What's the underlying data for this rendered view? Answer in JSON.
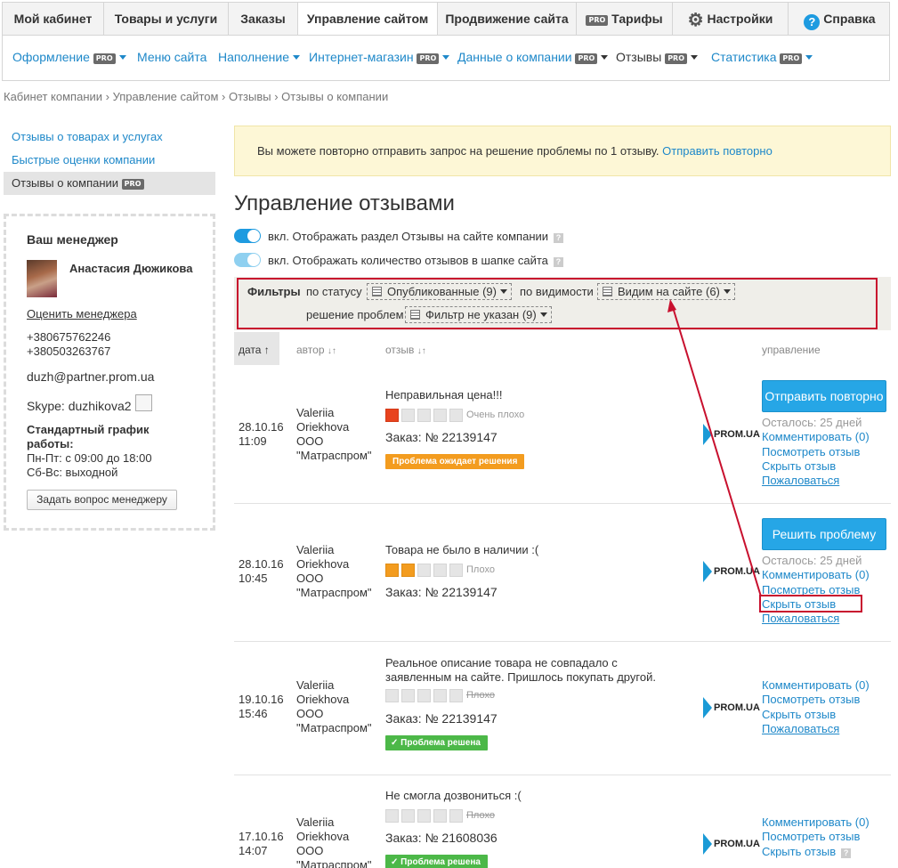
{
  "top_tabs": [
    {
      "label": "Мой кабинет"
    },
    {
      "label": "Товары и услуги"
    },
    {
      "label": "Заказы"
    },
    {
      "label": "Управление сайтом"
    },
    {
      "label": "Продвижение сайта"
    },
    {
      "label": "Тарифы",
      "pro": "PRO"
    },
    {
      "label": "Настройки"
    },
    {
      "label": "Справка"
    }
  ],
  "sub_nav": [
    {
      "label": "Оформление",
      "pro": "PRO"
    },
    {
      "label": "Меню сайта"
    },
    {
      "label": "Наполнение"
    },
    {
      "label": "Интернет-магазин",
      "pro": "PRO"
    },
    {
      "label": "Данные о компании",
      "pro": "PRO"
    },
    {
      "label": "Отзывы",
      "pro": "PRO"
    },
    {
      "label": "Статистика",
      "pro": "PRO"
    }
  ],
  "breadcrumb": "Кабинет компании › Управление сайтом › Отзывы › Отзывы о компании",
  "sidebar": {
    "items": [
      "Отзывы о товарах и услугах",
      "Быстрые оценки компании",
      "Отзывы о компании"
    ],
    "active_pro": "PRO"
  },
  "manager": {
    "title": "Ваш менеджер",
    "name": "Анастасия Дюжикова",
    "rate_link": "Оценить менеджера",
    "phone1": "+380675762246",
    "phone2": "+380503263767",
    "email": "duzh@partner.prom.ua",
    "skype": "Skype: duzhikova2",
    "schedule_title": "Стандартный график работы:",
    "schedule1": "Пн-Пт: с 09:00 до 18:00",
    "schedule2": "Сб-Вс: выходной",
    "ask_button": "Задать вопрос менеджеру"
  },
  "notice": {
    "text": "Вы можете повторно отправить запрос на решение проблемы по 1 отзыву.",
    "link": "Отправить повторно"
  },
  "page_title": "Управление отзывами",
  "toggles": [
    {
      "label": "вкл. Отображать раздел Отзывы на сайте компании",
      "on": true,
      "color": "#1e9be0"
    },
    {
      "label": "вкл. Отображать количество отзывов в шапке сайта",
      "on": true,
      "color": "#8fd0f0"
    }
  ],
  "filters": {
    "title": "Фильтры",
    "by_status": "по статусу",
    "status_value": "Опубликованные (9)",
    "by_visibility": "по видимости",
    "visibility_value": "Видим на сайте (6)",
    "by_problem": "решение проблем",
    "problem_value": "Фильтр не указан (9)"
  },
  "table_headers": {
    "date": "дата",
    "author": "автор",
    "review": "отзыв",
    "control": "управление"
  },
  "reviews": [
    {
      "date": "28.10.16",
      "time": "11:09",
      "author": [
        "Valeriia",
        "Oriekhova",
        "ООО",
        "\"Матраспром\""
      ],
      "title": "Неправильная цена!!!",
      "rating_text": "Очень плохо",
      "filled": 1,
      "fill_color": "red",
      "order": "Заказ: № 22139147",
      "badge": "Проблема ожидает решения",
      "button": "Отправить повторно",
      "remaining": "Осталось: 25 дней",
      "actions": [
        "Комментировать (0)",
        "Посмотреть отзыв",
        "Скрыть отзыв",
        "Пожаловаться"
      ]
    },
    {
      "date": "28.10.16",
      "time": "10:45",
      "author": [
        "Valeriia",
        "Oriekhova",
        "ООО",
        "\"Матраспром\""
      ],
      "title": "Товара не было в наличии :(",
      "rating_text": "Плохо",
      "filled": 2,
      "fill_color": "orange",
      "order": "Заказ: № 22139147",
      "button": "Решить проблему",
      "remaining": "Осталось: 25 дней",
      "actions": [
        "Комментировать (0)",
        "Посмотреть отзыв",
        "Скрыть отзыв",
        "Пожаловаться"
      ]
    },
    {
      "date": "19.10.16",
      "time": "15:46",
      "author": [
        "Valeriia",
        "Oriekhova",
        "ООО",
        "\"Матраспром\""
      ],
      "title_line1": "Реальное описание товара не совпадало с",
      "title_line2": "заявленным на сайте. Пришлось покупать другой.",
      "rating_text": "Плохо",
      "filled": 0,
      "order": "Заказ: № 22139147",
      "badge": "Проблема решена",
      "actions": [
        "Комментировать (0)",
        "Посмотреть отзыв",
        "Скрыть отзыв",
        "Пожаловаться"
      ]
    },
    {
      "date": "17.10.16",
      "time": "14:07",
      "author": [
        "Valeriia",
        "Oriekhova",
        "ООО",
        "\"Матраспром\""
      ],
      "title": "Не смогла дозвониться :(",
      "rating_text": "Плохо",
      "filled": 0,
      "order": "Заказ: № 21608036",
      "badge": "Проблема решена",
      "actions": [
        "Комментировать (0)",
        "Посмотреть отзыв",
        "Скрыть отзыв"
      ]
    }
  ],
  "prom_logo": "PROM.UA",
  "colors": {
    "link": "#1e88c9",
    "annotation": "#c8102e",
    "notice_bg": "#fdf7d6"
  }
}
